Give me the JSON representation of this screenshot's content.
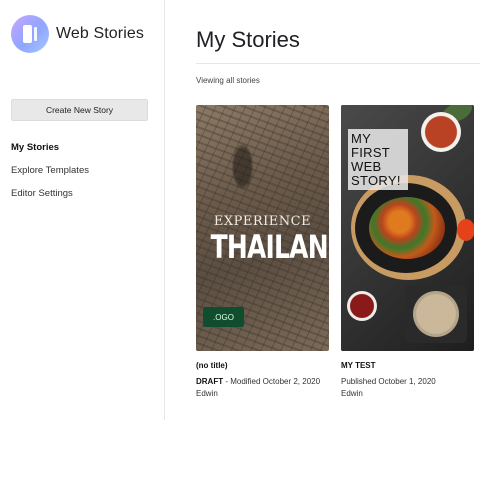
{
  "app": {
    "name": "Web Stories"
  },
  "sidebar": {
    "create_label": "Create New Story",
    "items": [
      {
        "label": "My Stories",
        "active": true
      },
      {
        "label": "Explore Templates",
        "active": false
      },
      {
        "label": "Editor Settings",
        "active": false
      }
    ]
  },
  "main": {
    "title": "My Stories",
    "filter_text": "Viewing all stories"
  },
  "stories": [
    {
      "cover_line1": "EXPERIENCE",
      "cover_line2": "THAILAND",
      "cover_logo": ".OGO",
      "title": "(no title)",
      "status": "DRAFT",
      "status_text": " - Modified October 2, 2020",
      "author": "Edwin"
    },
    {
      "cover_text": "MY FIRST WEB STORY!",
      "title": "MY TEST",
      "status_text": "Published October 1, 2020",
      "author": "Edwin"
    }
  ],
  "colors": {
    "logo_gradient_start": "#c9a7ff",
    "logo_gradient_end": "#8ea6ff",
    "badge_green": "#0f4d2e",
    "button_bg": "#e8e8e8"
  }
}
